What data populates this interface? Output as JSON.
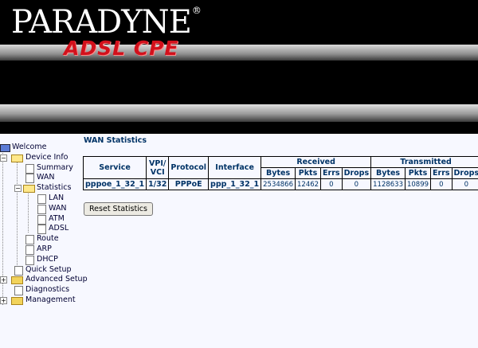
{
  "banner": {
    "brand": "PARADYNE",
    "registered": "®",
    "product": "ADSL CPE"
  },
  "nav": [
    {
      "label": "Welcome",
      "type": "root"
    },
    {
      "label": "Device Info",
      "type": "folder-open"
    },
    {
      "label": "Summary",
      "type": "page"
    },
    {
      "label": "WAN",
      "type": "page"
    },
    {
      "label": "Statistics",
      "type": "folder-open"
    },
    {
      "label": "LAN",
      "type": "page"
    },
    {
      "label": "WAN",
      "type": "page"
    },
    {
      "label": "ATM",
      "type": "page"
    },
    {
      "label": "ADSL",
      "type": "page"
    },
    {
      "label": "Route",
      "type": "page"
    },
    {
      "label": "ARP",
      "type": "page"
    },
    {
      "label": "DHCP",
      "type": "page"
    },
    {
      "label": "Quick Setup",
      "type": "page"
    },
    {
      "label": "Advanced Setup",
      "type": "folder"
    },
    {
      "label": "Diagnostics",
      "type": "page"
    },
    {
      "label": "Management",
      "type": "folder"
    }
  ],
  "page": {
    "title": "WAN Statistics",
    "reset_label": "Reset Statistics",
    "headers": {
      "service": "Service",
      "vpi_vci": "VPI/ VCI",
      "protocol": "Protocol",
      "interface": "Interface",
      "received": "Received",
      "transmitted": "Transmitted",
      "sub": [
        "Bytes",
        "Pkts",
        "Errs",
        "Drops",
        "Bytes",
        "Pkts",
        "Errs",
        "Drops"
      ]
    },
    "rows": [
      [
        "pppoe_1_32_1",
        "1/32",
        "PPPoE",
        "ppp_1_32_1",
        "2534866",
        "12462",
        "0",
        "0",
        "1128633",
        "10899",
        "0",
        "0"
      ]
    ]
  }
}
